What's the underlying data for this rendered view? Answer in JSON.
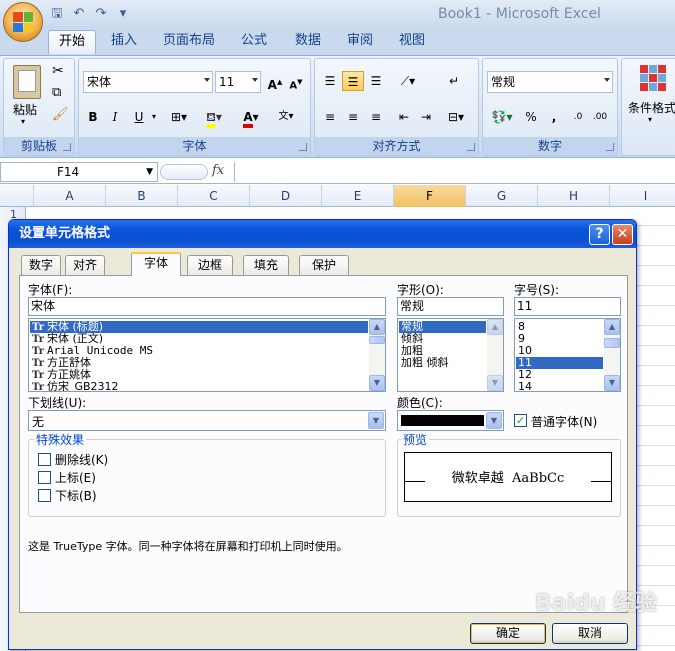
{
  "window": {
    "title": "Book1 - Microsoft Excel"
  },
  "ribbon": {
    "tabs": [
      "开始",
      "插入",
      "页面布局",
      "公式",
      "数据",
      "审阅",
      "视图"
    ],
    "clipboard": {
      "paste_label": "粘贴",
      "group_label": "剪贴板"
    },
    "font": {
      "font_name": "宋体",
      "font_size": "11",
      "group_label": "字体",
      "bold": "B",
      "italic": "I",
      "underline": "U"
    },
    "alignment": {
      "group_label": "对齐方式"
    },
    "number": {
      "format": "常规",
      "group_label": "数字",
      "percent": "%",
      "comma": ","
    },
    "styles": {
      "conditional_format_label": "条件格式"
    }
  },
  "formula_bar": {
    "cell_ref": "F14",
    "fx": "fx"
  },
  "sheet": {
    "columns": [
      "A",
      "B",
      "C",
      "D",
      "E",
      "F",
      "G",
      "H",
      "I"
    ],
    "selected_column": "F",
    "first_row": "1"
  },
  "dialog": {
    "title": "设置单元格格式",
    "help": "?",
    "tabs": [
      "数字",
      "对齐",
      "字体",
      "边框",
      "填充",
      "保护"
    ],
    "active_tab": "字体",
    "font_label": "字体(F):",
    "font_value": "宋体",
    "font_list": [
      "宋体 (标题)",
      "宋体 (正文)",
      "Arial Unicode MS",
      "方正舒体",
      "方正姚体",
      "仿宋_GB2312"
    ],
    "font_list_selected": "宋体 (标题)",
    "style_label": "字形(O):",
    "style_value": "常规",
    "style_list": [
      "常规",
      "倾斜",
      "加粗",
      "加粗 倾斜"
    ],
    "style_list_selected": "常规",
    "size_label": "字号(S):",
    "size_value": "11",
    "size_list": [
      "8",
      "9",
      "10",
      "11",
      "12",
      "14"
    ],
    "size_list_selected": "11",
    "underline_label": "下划线(U):",
    "underline_value": "无",
    "color_label": "颜色(C):",
    "color_value": "#000000",
    "normal_font_label": "普通字体(N)",
    "normal_font_checked": true,
    "effects_label": "特殊效果",
    "strikethrough_label": "删除线(K)",
    "superscript_label": "上标(E)",
    "subscript_label": "下标(B)",
    "preview_label": "预览",
    "preview_text": "微软卓越  AaBbCc",
    "note": "这是 TrueType 字体。同一种字体将在屏幕和打印机上同时使用。",
    "ok_label": "确定",
    "cancel_label": "取消"
  },
  "watermark": "Baidu 经验"
}
